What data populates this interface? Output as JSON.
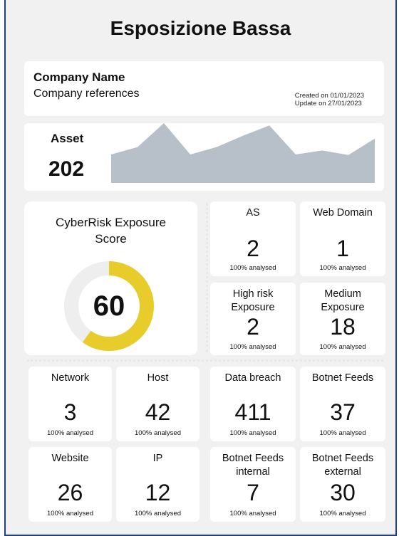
{
  "title": "Esposizione Bassa",
  "company": {
    "name": "Company Name",
    "references": "Company references",
    "created": "Created on 01/01/2023",
    "updated": "Update on 27/01/2023"
  },
  "asset": {
    "label": "Asset",
    "value": "202",
    "sparkline": [
      0.45,
      0.58,
      1.0,
      0.45,
      0.58,
      0.78,
      0.96,
      0.45,
      0.52,
      0.44,
      0.73
    ],
    "fill_color": "#b7c0c8"
  },
  "score": {
    "label": "CyberRisk Exposure Score",
    "value": "60",
    "percent": 60,
    "ring_color": "#e7cc2b",
    "track_color": "#eeeeee"
  },
  "tiles": {
    "as": {
      "label": "AS",
      "value": "2",
      "sub": "100% analysed"
    },
    "web_domain": {
      "label": "Web Domain",
      "value": "1",
      "sub": "100% analysed"
    },
    "high_risk": {
      "label": "High risk Exposure",
      "value": "2",
      "sub": "100% analysed"
    },
    "medium": {
      "label": "Medium Exposure",
      "value": "18",
      "sub": "100% analysed"
    },
    "network": {
      "label": "Network",
      "value": "3",
      "sub": "100% analysed"
    },
    "host": {
      "label": "Host",
      "value": "42",
      "sub": "100% analysed"
    },
    "data_breach": {
      "label": "Data breach",
      "value": "411",
      "sub": "100% analysed"
    },
    "botnet_feeds": {
      "label": "Botnet Feeds",
      "value": "37",
      "sub": "100% analysed"
    },
    "website": {
      "label": "Website",
      "value": "26",
      "sub": "100% analysed"
    },
    "ip": {
      "label": "IP",
      "value": "12",
      "sub": "100% analysed"
    },
    "botnet_internal": {
      "label": "Botnet Feeds internal",
      "value": "7",
      "sub": "100% analysed"
    },
    "botnet_external": {
      "label": "Botnet Feeds external",
      "value": "30",
      "sub": "100% analysed"
    }
  }
}
